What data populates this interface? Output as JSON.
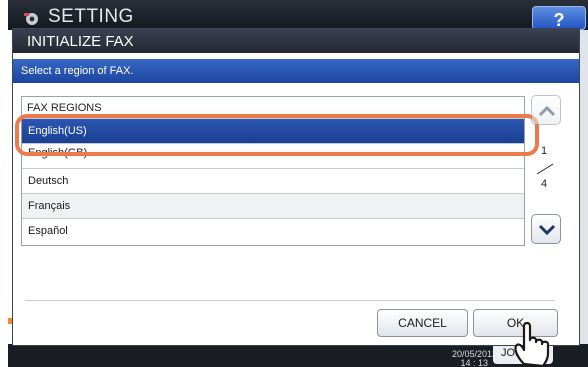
{
  "screen": {
    "title": "SETTING",
    "help_label": "?",
    "clock_date": "20/05/2012",
    "clock_time": "14 : 13",
    "job_status_label": "JOB S"
  },
  "dialog": {
    "title": "INITIALIZE FAX",
    "instruction": "Select a region of FAX.",
    "list_header": "FAX REGIONS",
    "regions": [
      {
        "label": "English(US)",
        "selected": true
      },
      {
        "label": "English(GB)",
        "selected": false
      },
      {
        "label": "Deutsch",
        "selected": false
      },
      {
        "label": "Français",
        "selected": false
      },
      {
        "label": "Español",
        "selected": false
      }
    ],
    "page_current": "1",
    "page_total": "4",
    "cancel_label": "CANCEL",
    "ok_label": "OK"
  },
  "colors": {
    "title_bar": "#2b303b",
    "instruction_bar": "#2a5bbd",
    "selected_row": "#24499f",
    "highlight": "#ee7a4c"
  }
}
